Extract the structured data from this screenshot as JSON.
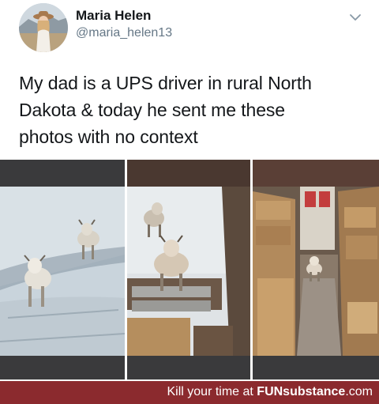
{
  "tweet": {
    "author_name": "Maria Helen",
    "author_handle": "@maria_helen13",
    "text_lines": [
      "My dad is a UPS driver in rural North",
      "Dakota & today he sent me these",
      "photos with no context"
    ],
    "avatar_icon": "profile-photo",
    "menu_icon": "chevron-down-icon",
    "photos": [
      {
        "alt_icon": "photo-goats-on-snowy-road"
      },
      {
        "alt_icon": "photo-goats-on-truck-steps"
      },
      {
        "alt_icon": "photo-goat-in-truck-cargo"
      }
    ]
  },
  "footer": {
    "prefix": "Kill your time at ",
    "brand": "FUNsubstance",
    "tld": ".com",
    "background_color": "#8b2a2e"
  }
}
